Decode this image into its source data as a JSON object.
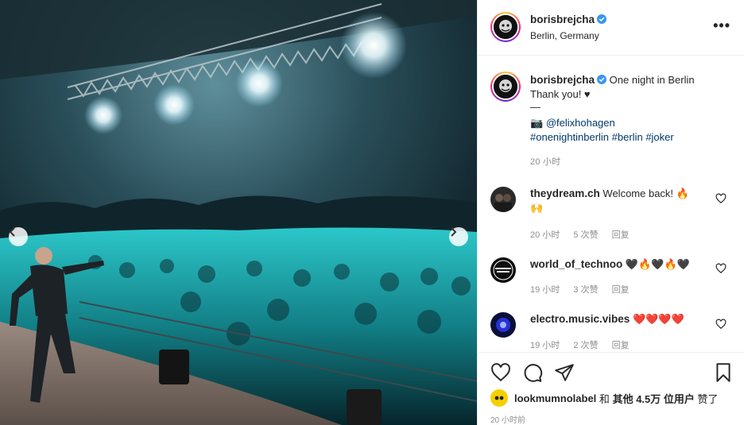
{
  "post": {
    "author": "borisbrejcha",
    "location": "Berlin, Germany",
    "caption_text": "One night in Berlin",
    "caption_line2": "Thank you! ♥",
    "caption_line3": "—",
    "camera_credit": "@felixhohagen",
    "hashtags": [
      "#onenightinberlin",
      "#berlin",
      "#joker"
    ],
    "caption_time": "20 小时",
    "more_label": "•••"
  },
  "comments": [
    {
      "user": "theydream.ch",
      "text": "Welcome back! 🔥",
      "text2": "🙌",
      "time": "20 小时",
      "likes": "5 次赞",
      "reply": "回复"
    },
    {
      "user": "world_of_technoo",
      "text": "🖤🔥🖤🔥🖤",
      "time": "19 小时",
      "likes": "3 次赞",
      "reply": "回复"
    },
    {
      "user": "electro.music.vibes",
      "text": "❤️❤️❤️❤️",
      "time": "19 小时",
      "likes": "2 次赞",
      "reply": "回复"
    }
  ],
  "likes": {
    "user": "lookmumnolabel",
    "connector": "和",
    "others_prefix": "其他",
    "count": "4.5万",
    "suffix": "位用户",
    "action": "赞了"
  },
  "post_time": "20 小时前",
  "colors": {
    "link": "#00376b",
    "verified": "#3897f0",
    "muted": "#8e8e8e"
  },
  "icons": [
    "chevron-left-icon",
    "chevron-right-icon",
    "heart-icon",
    "comment-icon",
    "share-icon",
    "bookmark-icon",
    "verified-icon",
    "more-icon"
  ]
}
